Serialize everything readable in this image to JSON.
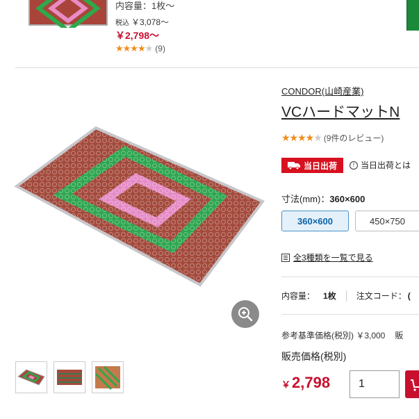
{
  "prev_item": {
    "capacity": "内容量：1枚〜",
    "tax_prefix": "税込",
    "tax_price": "￥3,078〜",
    "price": "￥2,798〜",
    "rating_stars": 4,
    "review_count": "(9)"
  },
  "product": {
    "brand": "CONDOR(山崎産業)",
    "title": "VCハードマットN",
    "rating_stars": 4,
    "review_text": "(9件のレビュー)",
    "sameday_badge": "当日出荷",
    "sameday_help": "当日出荷とは",
    "size_label": "寸法(mm)：",
    "size_value": "360×600",
    "sizes": [
      "360×600",
      "450×750"
    ],
    "list_link": "全3種類を一覧で見る",
    "capacity_label": "内容量：",
    "capacity_value": "1枚",
    "order_code_label": "注文コード：",
    "order_code_value": "(",
    "ref_price": "参考基準価格(税別) ￥3,000",
    "ref_price_tail": "販",
    "sale_label": "販売価格(税別)",
    "sale_currency": "￥",
    "sale_price": "2,798",
    "quantity": "1"
  },
  "icons": {
    "zoom": "zoom-in-icon",
    "truck": "truck-icon",
    "info": "info-icon",
    "list": "list-icon",
    "cart": "cart-icon"
  },
  "colors": {
    "accent_red": "#c8102e",
    "star_orange": "#f08c1a",
    "selected_blue": "#4a90c8"
  }
}
